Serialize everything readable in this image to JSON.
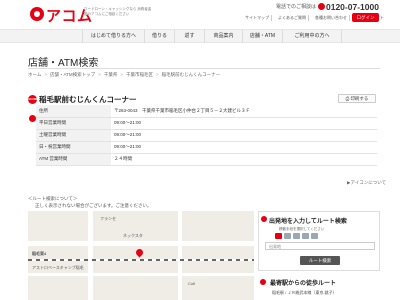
{
  "header": {
    "logo_text": "アコム",
    "logo_sub": "ワードローン・キャッシングなら 消費者金融のアコムにご相談ください",
    "tel_label": "電話でのご相談は",
    "tel_number": "0120-07-1000",
    "util_links": [
      "サイトマップ",
      "よくあるご質問",
      "各種お問い合わせ",
      "企業情報サイト"
    ],
    "login_label": "ログイン"
  },
  "nav": {
    "items": [
      "はじめて借りる方へ",
      "借りる",
      "返す",
      "商品案内",
      "店舗・ATM",
      "ご利用中の方へ"
    ]
  },
  "page": {
    "title": "店舗・ATM検索"
  },
  "breadcrumb": [
    "ホーム",
    "店舗・ATM検索トップ",
    "千葉県",
    "千葉市稲毛区",
    "稲毛駅前むじんくんコーナー"
  ],
  "store": {
    "badge": "ACOM",
    "name": "稲毛駅前むじんくんコーナー",
    "print_label": "印刷する",
    "rows": [
      {
        "label": "住所",
        "value": "〒263-0043　千葉県千葉市稲毛区小仲台２丁目５－２大建ビル３Ｆ"
      },
      {
        "label": "平日営業時間",
        "value": "09:00～21:00"
      },
      {
        "label": "土曜営業時間",
        "value": "09:00～21:00"
      },
      {
        "label": "日・祝営業時間",
        "value": "09:00～21:00"
      },
      {
        "label": "ATM 営業時間",
        "value": "２４時間"
      }
    ],
    "service_icons": [
      "card-icon",
      "atm-icon",
      "acom-icon",
      "atm24-icon"
    ],
    "icon_legend": "▶アイコンについて"
  },
  "route": {
    "help_text": "＜ルート検索について＞",
    "note_text": "正しく表示されない場合がございます。ご注意ください。",
    "panel_title": "出発地を入力してルート検索",
    "panel_sub": "移動手段を選択してください",
    "from_placeholder": "出発地",
    "go_label": "ルート検索"
  },
  "map": {
    "labels": [
      "フランセ",
      "稲毛東4",
      "アストロベースキャンプ稲毛",
      "ネックスタ",
      "Cofi"
    ]
  },
  "nearest": {
    "heading": "最寄駅からの徒歩ルート",
    "text": "稲毛駅 / ＪＲ総武本線（東京-銚子）"
  },
  "colors": {
    "brand_red": "#e60012",
    "nav_bg": "#f3f3f3",
    "table_head_bg": "#f2f2f2"
  }
}
